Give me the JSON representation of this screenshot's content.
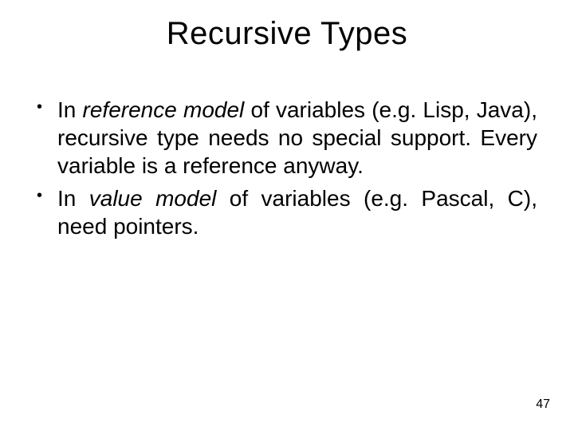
{
  "title": "Recursive Types",
  "bullets": {
    "b1": {
      "pre": "In ",
      "em": "reference model",
      "post": " of variables (e.g. Lisp, Java), recursive type needs no special support.  Every variable is a reference anyway."
    },
    "b2": {
      "pre": "In ",
      "em": "value model",
      "post": " of variables (e.g. Pascal, C), need pointers."
    }
  },
  "page_number": "47"
}
